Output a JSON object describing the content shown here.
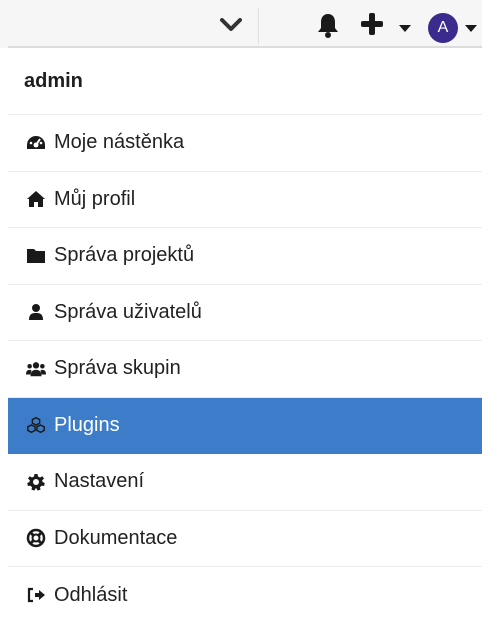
{
  "topbar": {
    "avatar_initial": "A",
    "icons": [
      "chevron-down-icon",
      "bell-icon",
      "plus-icon",
      "caret-down-icon",
      "caret-down-icon"
    ]
  },
  "menu": {
    "header": "admin",
    "items": [
      {
        "label": "Moje nástěnka",
        "icon": "dashboard-icon"
      },
      {
        "label": "Můj profil",
        "icon": "home-icon"
      },
      {
        "label": "Správa projektů",
        "icon": "folder-icon"
      },
      {
        "label": "Správa uživatelů",
        "icon": "user-icon"
      },
      {
        "label": "Správa skupin",
        "icon": "users-icon"
      },
      {
        "label": "Plugins",
        "icon": "cubes-icon",
        "active": true
      },
      {
        "label": "Nastavení",
        "icon": "cog-icon"
      },
      {
        "label": "Dokumentace",
        "icon": "life-ring-icon"
      },
      {
        "label": "Odhlásit",
        "icon": "sign-out-icon"
      }
    ]
  },
  "colors": {
    "active_bg": "#3d7cc9",
    "avatar_bg": "#3b2b8d",
    "topbar_bg": "#f6f6f6"
  }
}
